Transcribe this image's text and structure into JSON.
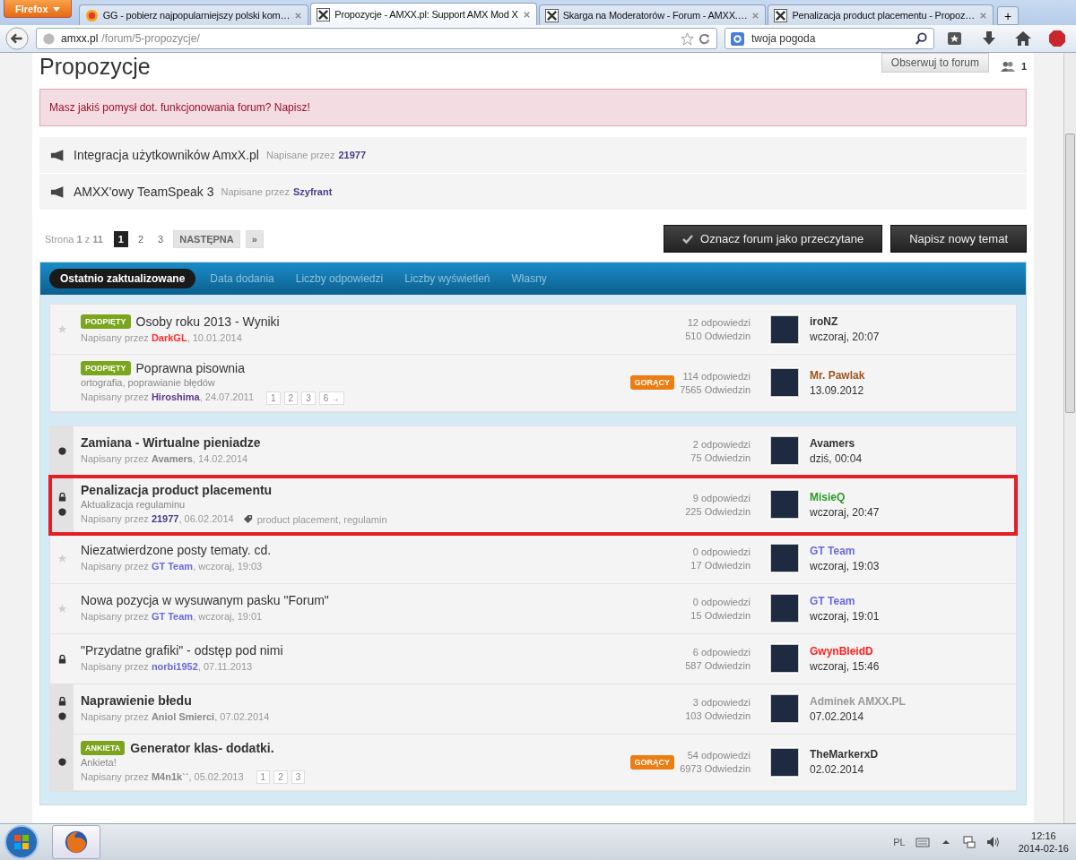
{
  "browser": {
    "menu_button": "Firefox",
    "tabs": [
      {
        "title": "GG - pobierz najpopularniejszy polski kom…",
        "selected": false
      },
      {
        "title": "Propozycje - AMXX.pl: Support AMX Mod X",
        "selected": true
      },
      {
        "title": "Skarga na Moderatorów - Forum - AMXX.…",
        "selected": false
      },
      {
        "title": "Penalizacja product placementu - Propoz…",
        "selected": false
      }
    ],
    "new_tab": "+",
    "url_host": "amxx.pl",
    "url_path": "/forum/5-propozycje/",
    "search_value": "twoja pogoda"
  },
  "forum": {
    "title": "Propozycje",
    "follow_button": "Obserwuj to forum",
    "followers": "1",
    "notice": "Masz jakiś pomysł dot. funkcjonowania forum? Napisz!",
    "announcements": [
      {
        "title": "Integracja użytkowników AmxX.pl",
        "by": "Napisane przez",
        "author": "21977"
      },
      {
        "title": "AMXX'owy TeamSpeak 3",
        "by": "Napisane przez",
        "author": "Szyfrant"
      }
    ],
    "pagination": {
      "label": "Strona **1** z **11**",
      "pages": [
        {
          "label": "1",
          "selected": true
        },
        {
          "label": "2",
          "selected": false
        },
        {
          "label": "3",
          "selected": false
        }
      ],
      "next": "NASTĘPNA",
      "last": "»"
    },
    "mark_read_button": "Oznacz forum jako przeczytane",
    "new_topic_button": "Napisz nowy temat",
    "sort_tabs": [
      {
        "label": "Ostatnio zaktualizowane",
        "selected": true
      },
      {
        "label": "Data dodania",
        "selected": false
      },
      {
        "label": "Liczby odpowiedzi",
        "selected": false
      },
      {
        "label": "Liczby wyświetleń",
        "selected": false
      },
      {
        "label": "Własny",
        "selected": false
      }
    ],
    "pinned_topics": [
      {
        "title": "Osoby roku 2013 - Wyniki",
        "badge": "PODPIĘTY",
        "starred": true,
        "locked": false,
        "unread": false,
        "highlighted": false,
        "by": "Napisany przez",
        "author": {
          "name": "DarkGL",
          "color": "#ff2b2b"
        },
        "date": ", 10.01.2014",
        "replies": "12 odpowiedzi",
        "views": "510 Odwiedzin",
        "last_post": {
          "user": "iroNZ",
          "color": "#333333",
          "date": "wczoraj, 20:07"
        }
      },
      {
        "title": "Poprawna pisownia",
        "badge": "PODPIĘTY",
        "hot": "GORĄCY",
        "starred": false,
        "locked": false,
        "unread": false,
        "highlighted": false,
        "description": "ortografia, poprawianie błędów",
        "by": "Napisany przez",
        "author": {
          "name": "Hiroshima",
          "color": "#5a3a8a"
        },
        "date": ", 24.07.2011",
        "pages": [
          "1",
          "2",
          "3",
          "6 →"
        ],
        "replies": "114 odpowiedzi",
        "views": "7565 Odwiedzin",
        "last_post": {
          "user": "Mr. Pawlak",
          "color": "#a0521a",
          "date": "13.09.2012"
        }
      }
    ],
    "topics": [
      {
        "title": "Zamiana - Wirtualne pieniadze",
        "starred": false,
        "locked": false,
        "unread": true,
        "highlighted": false,
        "by": "Napisany przez",
        "author": {
          "name": "Avamers",
          "color": "#888888"
        },
        "date": ", 14.02.2014",
        "replies": "2 odpowiedzi",
        "views": "75 Odwiedzin",
        "last_post": {
          "user": "Avamers",
          "color": "#333333",
          "date": "dziś, 00:04"
        }
      },
      {
        "title": "Penalizacja product placementu",
        "starred": false,
        "locked": true,
        "unread": true,
        "highlighted": true,
        "description": "Aktualizacja regulaminu",
        "by": "Napisany przez",
        "author": {
          "name": "21977",
          "color": "#4a3a8a"
        },
        "date": ", 06.02.2014",
        "tags": "product placement, regulamin",
        "replies": "9 odpowiedzi",
        "views": "225 Odwiedzin",
        "last_post": {
          "user": "MisieQ",
          "color": "#2a9a2a",
          "date": "wczoraj, 20:47"
        }
      },
      {
        "title": "Niezatwierdzone posty tematy. cd.",
        "starred": true,
        "locked": false,
        "unread": false,
        "highlighted": false,
        "by": "Napisany przez",
        "author": {
          "name": "GT Team",
          "color": "#6a6ae0"
        },
        "date": ", wczoraj, 19:03",
        "replies": "0 odpowiedzi",
        "views": "17 Odwiedzin",
        "last_post": {
          "user": "GT Team",
          "color": "#6a6ae0",
          "date": "wczoraj, 19:03"
        }
      },
      {
        "title": "Nowa pozycja w wysuwanym pasku \"Forum\"",
        "starred": true,
        "locked": false,
        "unread": false,
        "highlighted": false,
        "by": "Napisany przez",
        "author": {
          "name": "GT Team",
          "color": "#6a6ae0"
        },
        "date": ", wczoraj, 19:01",
        "replies": "0 odpowiedzi",
        "views": "15 Odwiedzin",
        "last_post": {
          "user": "GT Team",
          "color": "#6a6ae0",
          "date": "wczoraj, 19:01"
        }
      },
      {
        "title": "\"Przydatne grafiki\" - odstęp pod nimi",
        "starred": false,
        "locked": true,
        "unread": false,
        "highlighted": false,
        "by": "Napisany przez",
        "author": {
          "name": "norbi1952",
          "color": "#6a6ae0"
        },
        "date": ", 07.11.2013",
        "replies": "6 odpowiedzi",
        "views": "587 Odwiedzin",
        "last_post": {
          "user": "GwynBleidD",
          "color": "#ff2020",
          "date": "wczoraj, 15:46"
        }
      },
      {
        "title": "Naprawienie błedu",
        "starred": false,
        "locked": true,
        "unread": true,
        "highlighted": false,
        "by": "Napisany przez",
        "author": {
          "name": "Aniol Smierci",
          "color": "#888888"
        },
        "date": ", 07.02.2014",
        "replies": "3 odpowiedzi",
        "views": "103 Odwiedzin",
        "last_post": {
          "user": "Adminek AMXX.PL",
          "color": "#999999",
          "date": "07.02.2014"
        }
      },
      {
        "title": "Generator klas- dodatki.",
        "badge": "ANKIETA",
        "hot": "GORĄCY",
        "starred": false,
        "locked": false,
        "unread": true,
        "highlighted": false,
        "description": "Ankieta!",
        "by": "Napisany przez",
        "author": {
          "name": "M4n1k``",
          "color": "#888888"
        },
        "date": ", 05.02.2013",
        "pages": [
          "1",
          "2",
          "3"
        ],
        "replies": "54 odpowiedzi",
        "views": "6973 Odwiedzin",
        "last_post": {
          "user": "TheMarkerxD",
          "color": "#333333",
          "date": "02.02.2014"
        }
      }
    ]
  },
  "taskbar": {
    "language": "PL",
    "time": "12:16",
    "date": "2014-02-16"
  }
}
